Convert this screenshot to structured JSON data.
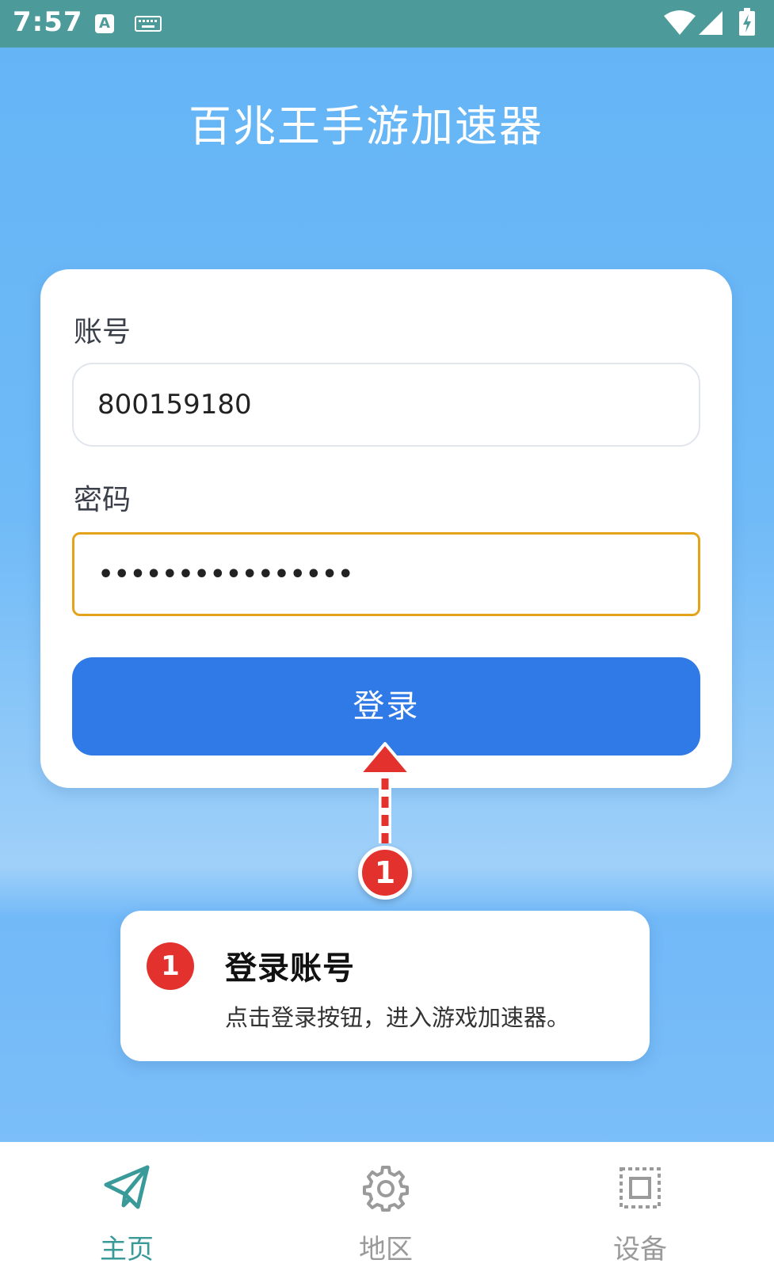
{
  "status_bar": {
    "time": "7:57",
    "input_indicator": "A"
  },
  "app": {
    "title": "百兆王手游加速器"
  },
  "login": {
    "account_label": "账号",
    "account_value": "800159180",
    "password_label": "密码",
    "password_value": "••••••••••••••••",
    "login_button": "登录"
  },
  "annotation": {
    "step_number": "1",
    "tip_title": "登录账号",
    "tip_description": "点击登录按钮，进入游戏加速器。"
  },
  "bottom_nav": {
    "items": [
      {
        "label": "主页",
        "icon": "paper-plane-icon",
        "active": true
      },
      {
        "label": "地区",
        "icon": "gear-icon",
        "active": false
      },
      {
        "label": "设备",
        "icon": "device-frame-icon",
        "active": false
      }
    ]
  },
  "colors": {
    "status_bar": "#4d9a9b",
    "background": "#64b4f6",
    "primary_button": "#2f7ae6",
    "focus_border": "#e3a41c",
    "badge_red": "#e3322e",
    "nav_active": "#3a9a9a",
    "nav_inactive": "#9a9a9a"
  }
}
